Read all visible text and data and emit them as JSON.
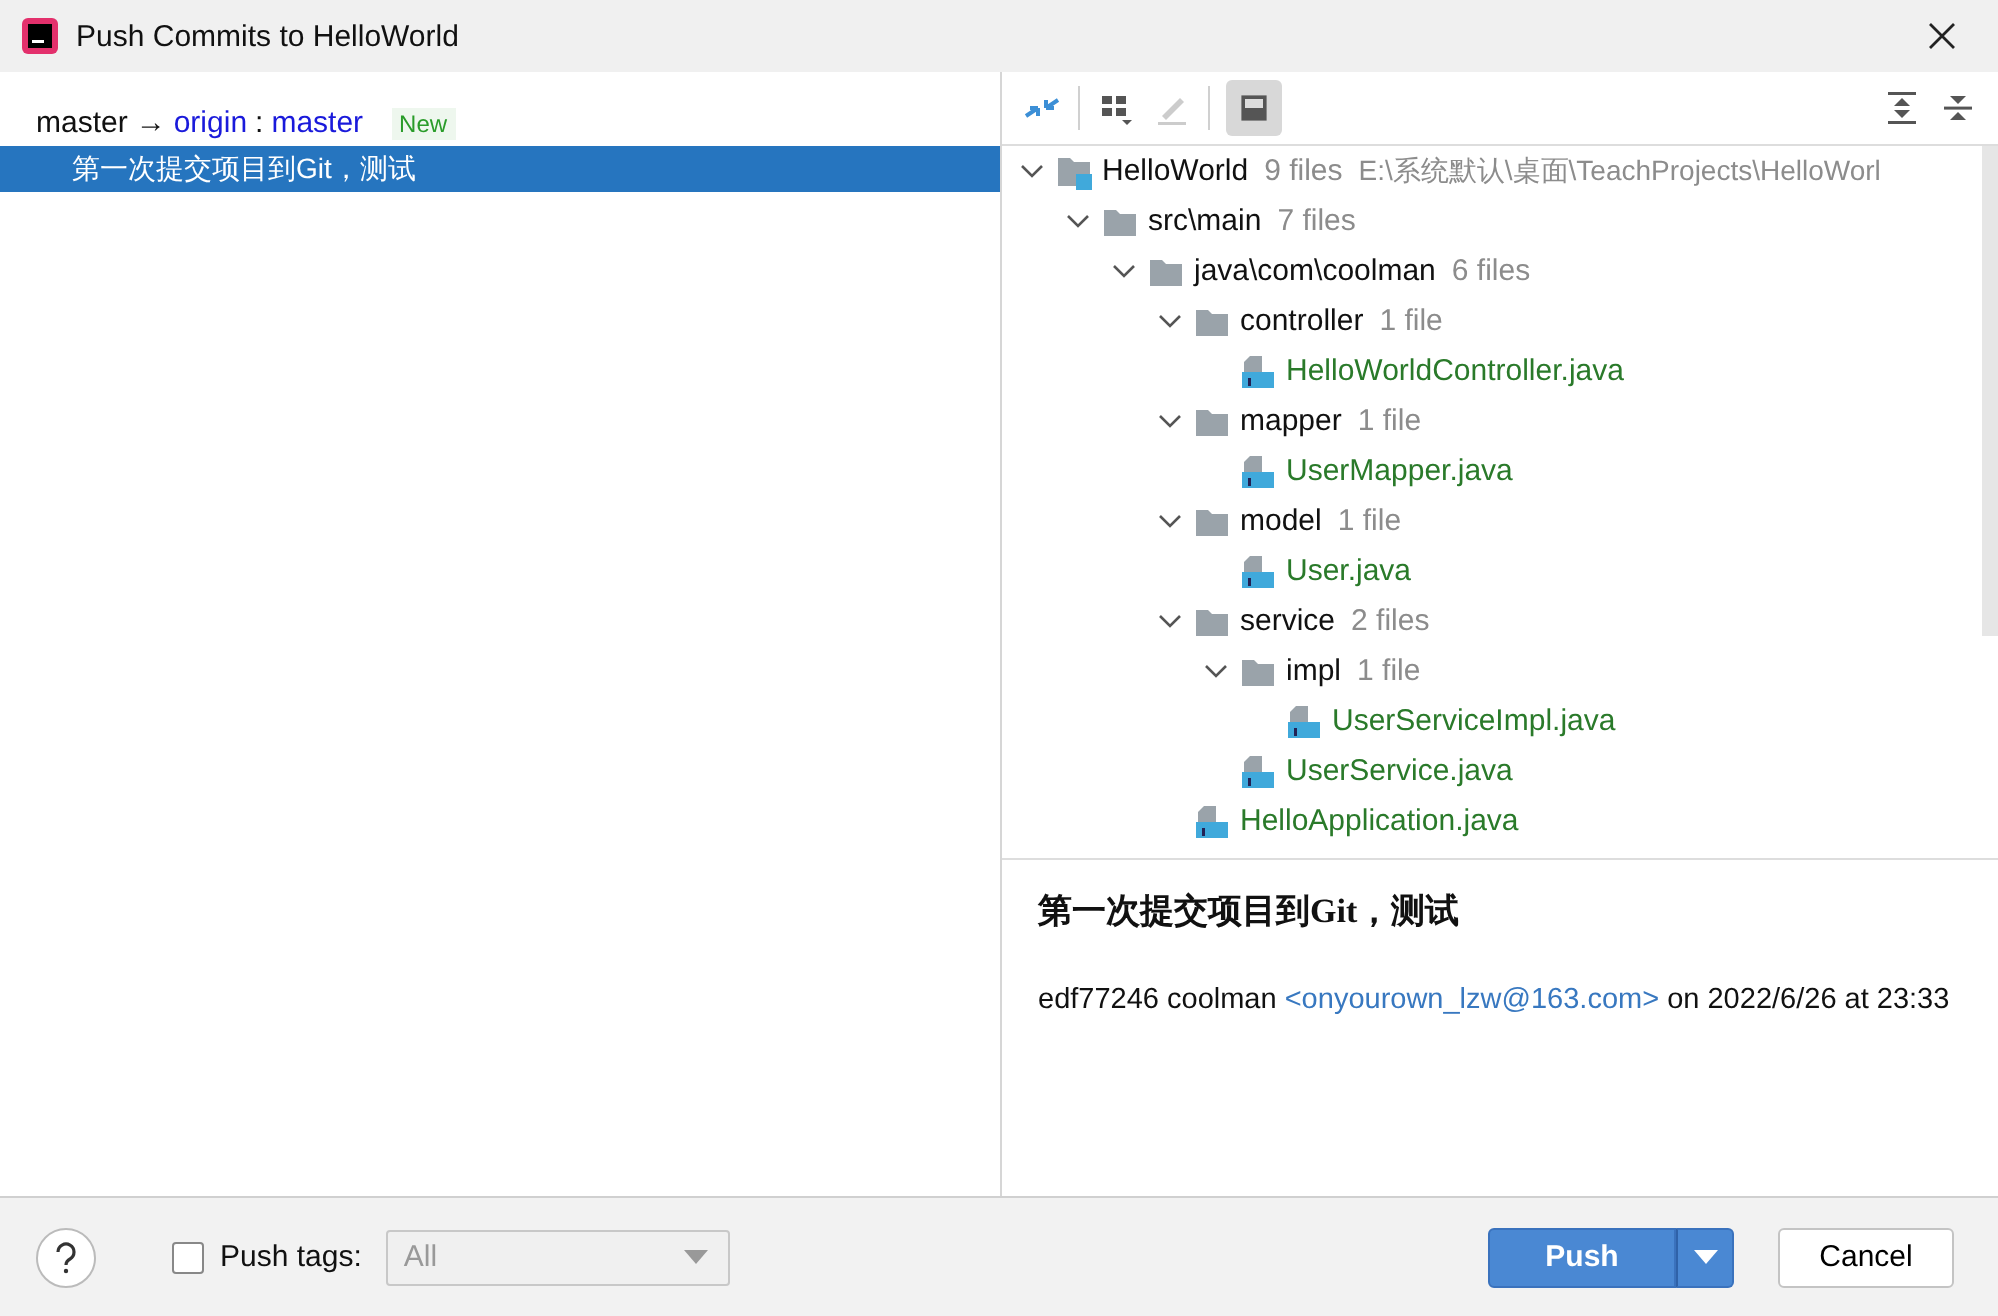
{
  "window": {
    "title": "Push Commits to HelloWorld"
  },
  "push_target": {
    "local_branch": "master",
    "arrow": "→",
    "remote": "origin",
    "separator": ":",
    "remote_branch": "master",
    "badge": "New"
  },
  "commits": [
    {
      "message": "第一次提交项目到Git，测试",
      "selected": true
    }
  ],
  "toolbar": {
    "view_options_pressed": true
  },
  "tree": [
    {
      "kind": "module",
      "name": "HelloWorld",
      "count": "9 files",
      "path": "E:\\系统默认\\桌面\\TeachProjects\\HelloWorl",
      "expanded": true,
      "children": [
        {
          "kind": "folder",
          "name": "src\\main",
          "count": "7 files",
          "expanded": true,
          "children": [
            {
              "kind": "folder",
              "name": "java\\com\\coolman",
              "count": "6 files",
              "expanded": true,
              "children": [
                {
                  "kind": "folder",
                  "name": "controller",
                  "count": "1 file",
                  "expanded": true,
                  "children": [
                    {
                      "kind": "file",
                      "name": "HelloWorldController.java"
                    }
                  ]
                },
                {
                  "kind": "folder",
                  "name": "mapper",
                  "count": "1 file",
                  "expanded": true,
                  "children": [
                    {
                      "kind": "file",
                      "name": "UserMapper.java"
                    }
                  ]
                },
                {
                  "kind": "folder",
                  "name": "model",
                  "count": "1 file",
                  "expanded": true,
                  "children": [
                    {
                      "kind": "file",
                      "name": "User.java"
                    }
                  ]
                },
                {
                  "kind": "folder",
                  "name": "service",
                  "count": "2 files",
                  "expanded": true,
                  "children": [
                    {
                      "kind": "folder",
                      "name": "impl",
                      "count": "1 file",
                      "expanded": true,
                      "children": [
                        {
                          "kind": "file",
                          "name": "UserServiceImpl.java"
                        }
                      ]
                    },
                    {
                      "kind": "file",
                      "name": "UserService.java"
                    }
                  ]
                },
                {
                  "kind": "file",
                  "name": "HelloApplication.java"
                }
              ]
            }
          ]
        }
      ]
    }
  ],
  "details": {
    "subject": "第一次提交项目到Git，测试",
    "hash": "edf77246",
    "author": "coolman",
    "email": "<onyourown_lzw@163.com>",
    "date": "on 2022/6/26 at 23:33"
  },
  "footer": {
    "push_tags": {
      "label": "Push tags:",
      "checked": false,
      "value": "All",
      "disabled": true
    },
    "push_button": "Push",
    "cancel_button": "Cancel"
  }
}
